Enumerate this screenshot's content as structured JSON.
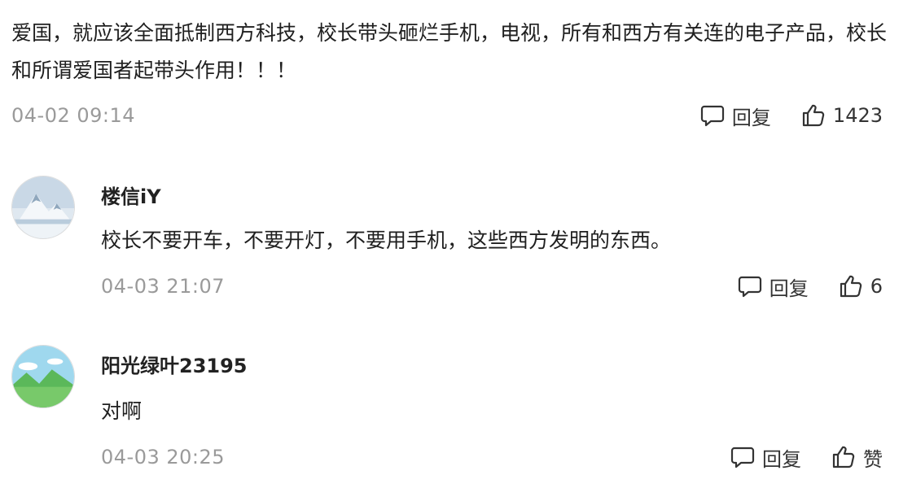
{
  "comments": [
    {
      "text": "爱国，就应该全面抵制西方科技，校长带头砸烂手机，电视，所有和西方有关连的电子产品，校长和所谓爱国者起带头作用！！！",
      "timestamp": "04-02 09:14",
      "reply_label": "回复",
      "like_label": "1423"
    },
    {
      "username": "楼信iY",
      "text": "校长不要开车，不要开灯，不要用手机，这些西方发明的东西。",
      "timestamp": "04-03 21:07",
      "reply_label": "回复",
      "like_label": "6",
      "avatar_icon": "snow-mountain-avatar"
    },
    {
      "username": "阳光绿叶23195",
      "text": "对啊",
      "timestamp": "04-03 20:25",
      "reply_label": "回复",
      "like_label": "赞",
      "avatar_icon": "green-hills-avatar"
    }
  ],
  "icons": {
    "reply": "comment-bubble-icon",
    "like": "thumbs-up-icon"
  },
  "colors": {
    "timestamp": "#9a9a9a",
    "text": "#1f1f1f",
    "username": "#222222"
  }
}
